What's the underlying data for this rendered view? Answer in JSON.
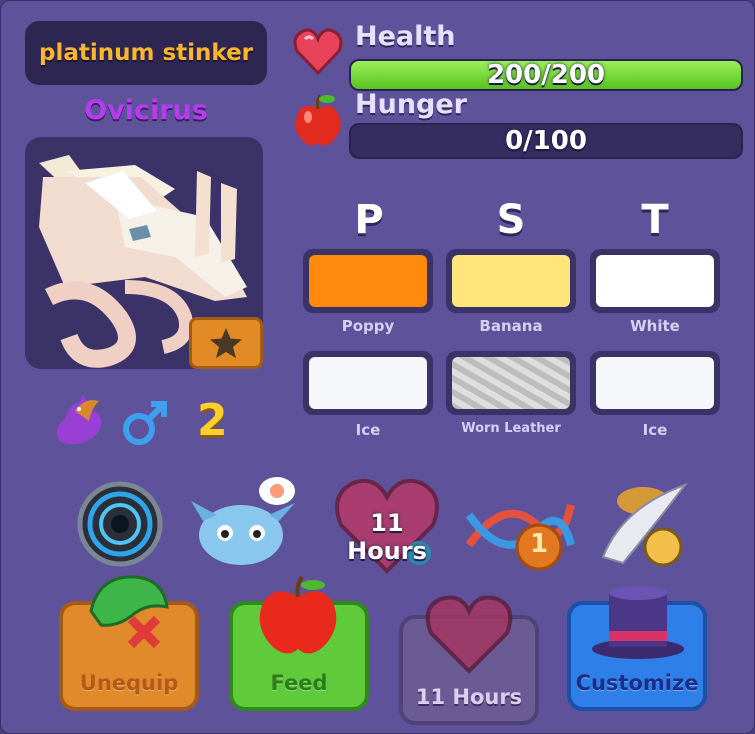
{
  "pet": {
    "name": "platinum stinker",
    "species": "Ovicirus",
    "age": "2"
  },
  "stats": {
    "health_label": "Health",
    "health_text": "200/200",
    "health_fraction": 1.0,
    "hunger_label": "Hunger",
    "hunger_text": "0/100",
    "hunger_fraction": 0.0
  },
  "colors": {
    "headers": [
      "P",
      "S",
      "T"
    ],
    "row1": [
      {
        "label": "Poppy",
        "hex": "#ff8a0c"
      },
      {
        "label": "Banana",
        "hex": "#ffe57a"
      },
      {
        "label": "White",
        "hex": "#ffffff"
      }
    ],
    "row2": [
      {
        "label": "Ice",
        "hex": "#f6f7fa"
      },
      {
        "label": "Worn Leather",
        "hex": "#cfcfcf"
      },
      {
        "label": "Ice",
        "hex": "#f6f7fa"
      }
    ]
  },
  "items": {
    "timer_text": "11 Hours",
    "dna_count": "1"
  },
  "actions": {
    "unequip": "Unequip",
    "feed": "Feed",
    "hours": "11 Hours",
    "customize": "Customize"
  }
}
